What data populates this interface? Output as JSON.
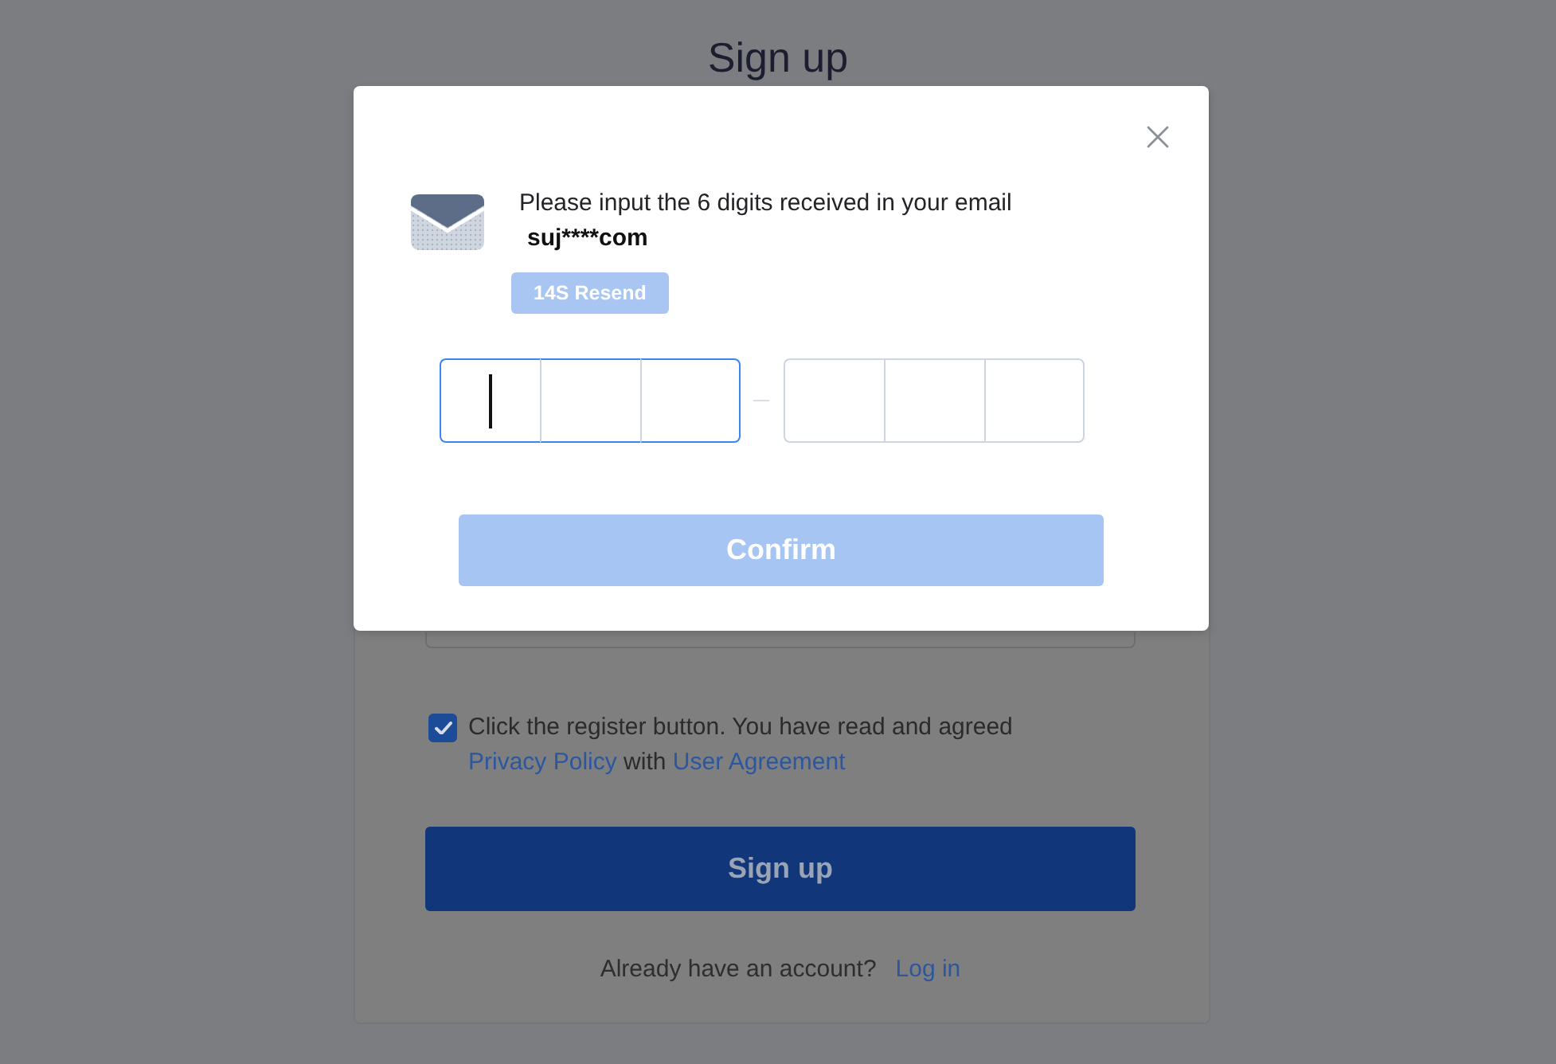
{
  "page": {
    "title": "Sign up"
  },
  "agreement": {
    "checked": true,
    "parts": [
      {
        "kind": "text",
        "text": "Click the register button. You have read and agreed"
      },
      {
        "kind": "link",
        "text": "Privacy Policy"
      },
      {
        "kind": "text",
        "text": "with"
      },
      {
        "kind": "link",
        "text": "User Agreement"
      }
    ]
  },
  "signup_button": {
    "label": "Sign up"
  },
  "login_prompt": {
    "text": "Already have an account?",
    "link": "Log in"
  },
  "modal": {
    "message": "Please input the 6 digits received in your email",
    "email": "suj****com",
    "resend_button": {
      "label": "14S Resend",
      "disabled": true
    },
    "code_cells": [
      {
        "focused": true
      },
      {
        "focused": false
      },
      {
        "focused": false
      },
      {
        "focused": false
      },
      {
        "focused": false
      },
      {
        "focused": false
      }
    ],
    "confirm_button": {
      "label": "Confirm",
      "disabled": true
    }
  }
}
